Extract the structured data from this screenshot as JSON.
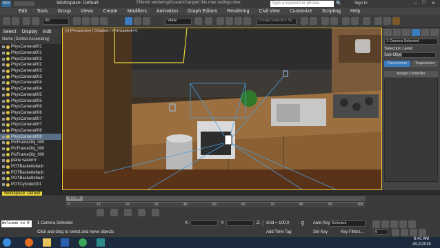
{
  "window": {
    "app_menu_label": "MAX",
    "workspace": "Workspace: Default",
    "title": "Elifemir rendering\\Ocean\\changed 3ds max settings.max",
    "search_placeholder": "Type a keyword or phrase",
    "sign_in": "Sign In"
  },
  "menu": [
    "Edit",
    "Tools",
    "Group",
    "Views",
    "Create",
    "Modifiers",
    "Animation",
    "Graph Editors",
    "Rendering",
    "Civil View",
    "Customize",
    "Scripting",
    "Help"
  ],
  "toolbar": {
    "selection_filter": "All",
    "coord_system": "View",
    "selection_set_placeholder": "Create Selection Se"
  },
  "explorer": {
    "tabs": [
      "Select",
      "Display",
      "Edit"
    ],
    "header": "Name (Sorted Ascending)",
    "items": [
      "PhysCamera001",
      "PhysCamera001",
      "PhysCamera002",
      "PhysCamera002",
      "PhysCamera003",
      "PhysCamera003",
      "PhysCamera004",
      "PhysCamera004",
      "PhysCamera005",
      "PhysCamera005",
      "PhysCamera006",
      "PhysCamera006",
      "PhysCamera007",
      "PhysCamera007",
      "PhysCamera008",
      "PhysCamera008",
      "PicFrameObj_000",
      "PicFrameObj_000",
      "PicFrameObj_000",
      "plane waterrrr",
      "POTBaskettefault",
      "POTBaskettefault",
      "POTBaskettefault",
      "POTCylinder001"
    ],
    "selected_index": 15,
    "workspace_footer": "Workspace: Default"
  },
  "viewport": {
    "label": "[+] [Perspective ] [Shaded ] [<<Disabled>>]"
  },
  "command_panel": {
    "object_name": "1 Camera Selected",
    "selection_level_label": "Selection Level:",
    "sub_object_label": "Sub-Object",
    "tabs": [
      "Parameters",
      "Trajectories"
    ],
    "rollout": "Assign Controller"
  },
  "timeline": {
    "frame_counter": "0 / 100",
    "ticks": [
      "0",
      "10",
      "20",
      "30",
      "40",
      "50",
      "60",
      "70",
      "80",
      "90",
      "100"
    ]
  },
  "status": {
    "maxscript": "Welcome to M",
    "selected": "1 Camera Selected",
    "prompt": "Click and drag to select and move objects",
    "x_label": "X:",
    "y_label": "Y:",
    "z_label": "Z:",
    "grid": "Grid = 100,0",
    "add_time_tag": "Add Time Tag",
    "auto_key": "Auto Key",
    "selected_dropdown": "Selected",
    "set_key": "Set Key",
    "key_filters": "Key Filters...",
    "current_frame": "0"
  },
  "taskbar": {
    "time": "6:41 AM",
    "date": "4/12/2015"
  }
}
